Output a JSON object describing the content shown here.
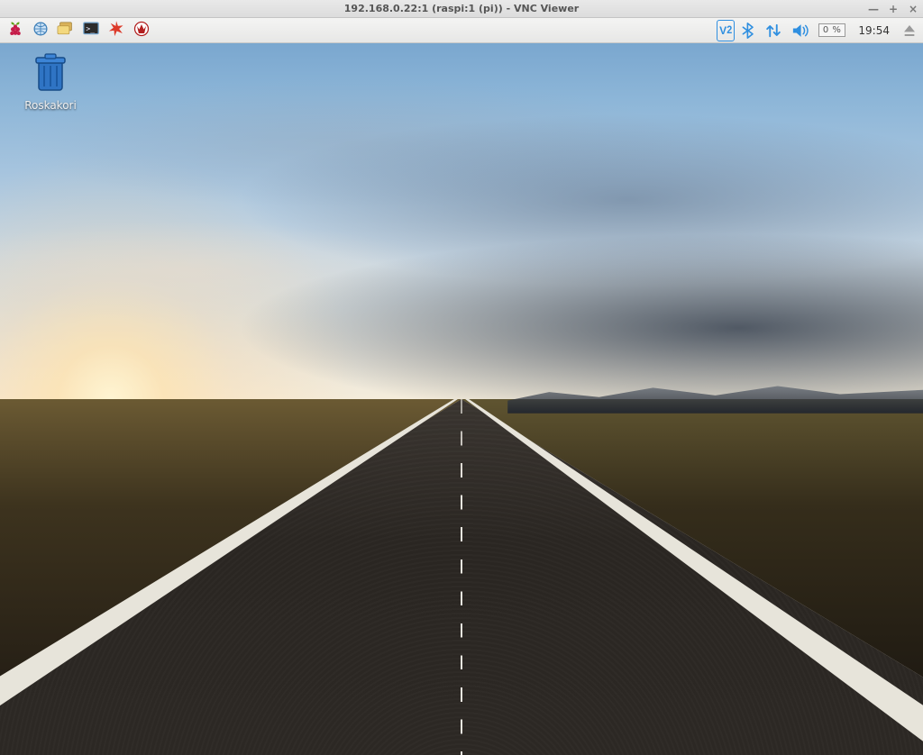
{
  "window": {
    "title": "192.168.0.22:1 (raspi:1 (pi)) - VNC Viewer",
    "controls": {
      "minimize": "—",
      "maximize": "+",
      "close": "×"
    }
  },
  "panel": {
    "launchers": [
      {
        "name": "menu-raspberry",
        "icon": "raspberry"
      },
      {
        "name": "web-browser",
        "icon": "globe"
      },
      {
        "name": "file-manager",
        "icon": "folders"
      },
      {
        "name": "terminal",
        "icon": "terminal"
      },
      {
        "name": "mathematica",
        "icon": "spiky"
      },
      {
        "name": "wolfram",
        "icon": "wolf"
      }
    ],
    "tray": {
      "vnc": "VNC",
      "bluetooth": "bluetooth",
      "network": "updown",
      "volume": "speaker",
      "cpu": "0 %",
      "clock": "19:54",
      "eject": "eject"
    }
  },
  "desktop": {
    "icons": [
      {
        "name": "trash",
        "label": "Roskakori"
      }
    ]
  }
}
